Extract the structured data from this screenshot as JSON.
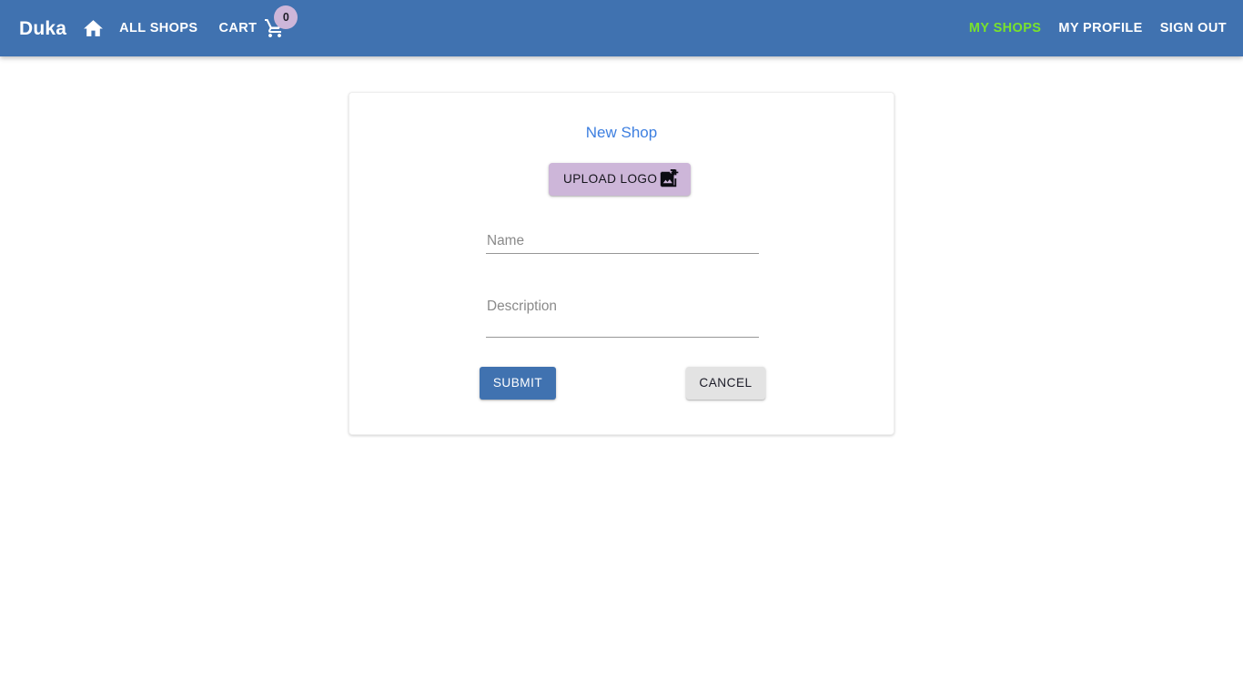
{
  "navbar": {
    "brand": "Duka",
    "home_icon": "home-icon",
    "all_shops_label": "ALL SHOPS",
    "cart_label": "CART",
    "cart_icon": "shopping-cart-icon",
    "cart_count": "0",
    "my_shops_label": "MY SHOPS",
    "my_profile_label": "MY PROFILE",
    "sign_out_label": "SIGN OUT",
    "background_color": "#4072b0",
    "active_link_color": "#79e22c",
    "badge_color": "#cdb6d9"
  },
  "card": {
    "title": "New Shop",
    "title_color": "#3d7fe0",
    "upload": {
      "label": "UPLOAD LOGO",
      "icon": "add-photo-alternate-icon",
      "background_color": "#cdb6d9"
    },
    "fields": [
      {
        "name": "name",
        "placeholder": "Name",
        "value": ""
      },
      {
        "name": "description",
        "placeholder": "Description",
        "value": ""
      }
    ],
    "actions": {
      "submit_label": "SUBMIT",
      "submit_color": "#4072b0",
      "cancel_label": "CANCEL",
      "cancel_color": "#e3e3e3"
    }
  }
}
